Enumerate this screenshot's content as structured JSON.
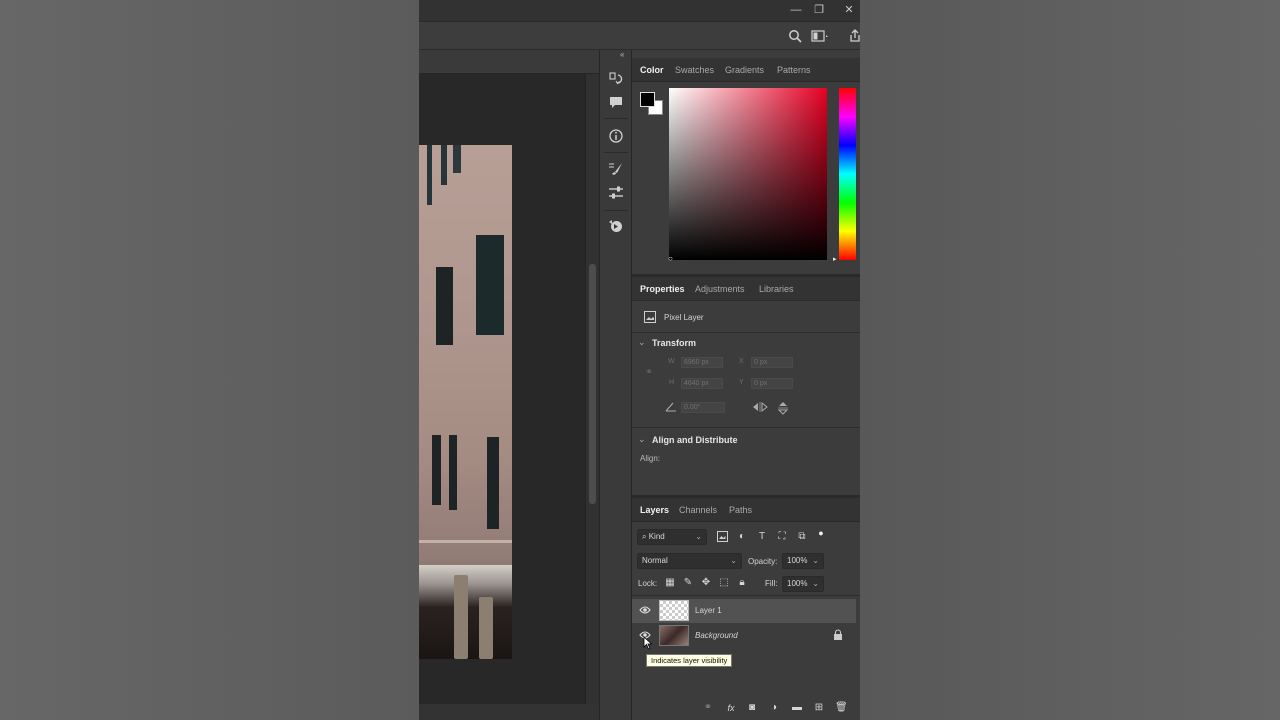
{
  "colors": {
    "panel_bg": "#3c3c3c",
    "tab_active": "#f0f0f0",
    "tooltip_bg": "#ffffe1",
    "hue_top": "#ff0000",
    "picker_hue": "#e60023"
  },
  "window": {
    "minimize": "—",
    "restore": "❐",
    "close": "✕"
  },
  "options_bar": {
    "icons": [
      "search-icon",
      "workspace-icon",
      "share-icon"
    ]
  },
  "icon_strip": {
    "collapse": "«",
    "icons": [
      "history-icon",
      "comment-icon",
      "info-icon",
      "brush-settings-icon",
      "adjustments-icon",
      "actions-icon"
    ]
  },
  "color_panel": {
    "tabs": [
      "Color",
      "Swatches",
      "Gradients",
      "Patterns"
    ],
    "active_tab": "Color",
    "foreground": "#000000",
    "background": "#ffffff"
  },
  "properties_panel": {
    "tabs": [
      "Properties",
      "Adjustments",
      "Libraries"
    ],
    "active_tab": "Properties",
    "layer_type": "Pixel Layer",
    "transform": {
      "title": "Transform",
      "w_label": "W",
      "w_value": "6960 px",
      "x_label": "X",
      "x_value": "0 px",
      "h_label": "H",
      "h_value": "4640 px",
      "y_label": "Y",
      "y_value": "0 px",
      "angle_value": "0.00°"
    },
    "align": {
      "title": "Align and Distribute",
      "label": "Align:"
    }
  },
  "layers_panel": {
    "tabs": [
      "Layers",
      "Channels",
      "Paths"
    ],
    "active_tab": "Layers",
    "filter_label": "Kind",
    "blend_mode": "Normal",
    "opacity_label": "Opacity:",
    "opacity_value": "100%",
    "lock_label": "Lock:",
    "fill_label": "Fill:",
    "fill_value": "100%",
    "layers": [
      {
        "name": "Layer 1",
        "visible": true,
        "selected": true
      },
      {
        "name": "Background",
        "visible": true,
        "locked": true
      }
    ],
    "tooltip": "Indicates layer visibility"
  }
}
